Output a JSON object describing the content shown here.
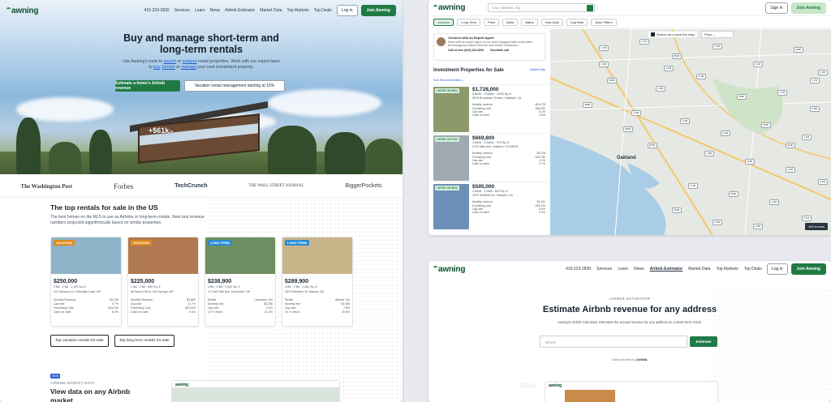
{
  "left": {
    "nav": {
      "logo": "awning",
      "phone": "415-223-2830",
      "links": [
        "Services",
        "Learn",
        "News",
        "Airbnb Estimator",
        "Market Data",
        "Top Markets",
        "Top Deals"
      ],
      "login": "Log in",
      "join": "Join Awning"
    },
    "hero": {
      "title": "Buy and manage short-term and long-term rentals",
      "subtitle_prefix": "Use Awning's tools to",
      "link_search": "search",
      "subtitle_or": "or",
      "link_analyze": "analyze",
      "subtitle_mid": "rental properties. Work with our expert team to",
      "link_buy": "buy",
      "link_furnish": "furnish",
      "subtitle_or2": "or",
      "link_manage": "manage",
      "subtitle_end": "your next investment property.",
      "cta_primary": "Estimate a home's Airbnb revenue",
      "cta_secondary": "Vacation rental management starting at 15%",
      "price_badge": "+$61k",
      "price_unit": "/yr"
    },
    "press": [
      "The Washington Post",
      "Forbes",
      "TechCrunch",
      "THE WALL STREET JOURNAL",
      "BiggerPockets"
    ],
    "top_rentals": {
      "title": "The top rentals for sale in the US",
      "subtitle": "The best homes on the MLS to use as Airbnbs or long-term rentals. Rent and revenue numbers projected algorithmically based on similar properties."
    },
    "cards": [
      {
        "tag": "VACATION",
        "tag_color": "#e08a1e",
        "price": "$250,000",
        "meta": "3 Bd · 2 Ba · 1,193 Sq. ft",
        "address": "101 Shepard Ln, Mountain Lake, AR",
        "rows": [
          [
            "Monthly Revenue",
            "$3,128"
          ],
          [
            "Cap rate",
            "9.7%"
          ],
          [
            "Furnishing Cost",
            "$14,226"
          ],
          [
            "Cash on cash",
            "8.4%"
          ]
        ],
        "img_color": "#8fb3c8"
      },
      {
        "tag": "VACATION",
        "tag_color": "#e08a1e",
        "price": "$225,000",
        "meta": "2 Bd · 1 Ba · 820 Sq. ft",
        "address": "88 Stone Hill Dr, Hot Springs, AR",
        "rows": [
          [
            "Monthly Revenue",
            "$3,880"
          ],
          [
            "Cap rate",
            "11.7%"
          ],
          [
            "Furnishing Cost",
            "$22,000"
          ],
          [
            "Cash on cash",
            "9.4%"
          ]
        ],
        "img_color": "#b0794f"
      },
      {
        "tag": "LONG TERM",
        "tag_color": "#2a8bd6",
        "price": "$238,900",
        "meta": "4 Bd · 2 Ba · 2,020 Sq. ft",
        "address": "12 Oak Park Ave, Cleveland, OH",
        "rows": [
          [
            "Rental",
            "Cleveland, OH"
          ],
          [
            "Monthly rent",
            "$2,250"
          ],
          [
            "Cap rate",
            "9.0%"
          ],
          [
            "10 Yr return",
            "21.3%"
          ]
        ],
        "img_color": "#6e8f62"
      },
      {
        "tag": "LONG TERM",
        "tag_color": "#2a8bd6",
        "price": "$289,900",
        "meta": "3 Bd · 2 Ba · 1,282 Sq. ft",
        "address": "450 Peachtree St, Atlanta, GA",
        "rows": [
          [
            "Rental",
            "Atlanta, GA"
          ],
          [
            "Monthly rent",
            "$2,350"
          ],
          [
            "Cap rate",
            "7.8%"
          ],
          [
            "10 Yr return",
            "19.9%"
          ]
        ],
        "img_color": "#c9b48a"
      }
    ],
    "btn_vacation": "Top vacation rentals for sale",
    "btn_longterm": "Top long term rentals for sale",
    "market": {
      "badge": "NEW",
      "eyebrow": "AIRBNB MARKET DATA",
      "title": "View data on any Airbnb market"
    }
  },
  "top_right": {
    "logo": "awning",
    "search_placeholder": "City, Address, Zip",
    "signin": "Sign in",
    "join": "Join Awning",
    "filters": [
      "Vacation",
      "Long Term",
      "Price",
      "Beds",
      "Baths",
      "Year Built",
      "Cap Rate",
      "More Filters"
    ],
    "expert": {
      "title": "Connect with an Expert Agent",
      "body": "Work with an expert agent on our team equipped with world-class technology and data to find the best Airbnb investment.",
      "call": "Call or text (415) 223-2830",
      "schedule": "Schedule call"
    },
    "list_title": "Investment Properties for Sale",
    "market_data": "Market Data",
    "sort_label": "Sort",
    "sort_value": "Recommended",
    "props": [
      {
        "tag": "LISTED ON 09/04",
        "price": "$1,728,000",
        "meta": "6 Beds · 3 Baths · 4,535 Sq. ft",
        "address": "3675 Broadway Terrace, Oakland, CA",
        "rows": [
          [
            "Monthly revenue",
            "$15,278"
          ],
          [
            "Furnishing cost",
            "$48,990"
          ],
          [
            "Cap rate",
            "5.1%"
          ],
          [
            "Cash on cash",
            "3.6%"
          ]
        ],
        "img_color": "#8c9a6a"
      },
      {
        "tag": "LISTED ON 07/22",
        "price": "$669,800",
        "meta": "3 Beds · 2 Baths · 978 Sq. ft",
        "address": "2723 38th Ave, Oakland, CA 94619",
        "rows": [
          [
            "Monthly revenue",
            "$3,078"
          ],
          [
            "Furnishing cost",
            "$18,780"
          ],
          [
            "Cap rate",
            "4.1%"
          ],
          [
            "Cash on cash",
            "2.7%"
          ]
        ],
        "img_color": "#9ea9b2"
      },
      {
        "tag": "LISTED ON 09/13",
        "price": "$595,000",
        "meta": "2 Beds · 1 Bath · 823 Sq. ft",
        "address": "2570 Sheffield Dr, Oakland, CA",
        "rows": [
          [
            "Monthly revenue",
            "$4,161"
          ],
          [
            "Furnishing cost",
            "$15,220"
          ],
          [
            "Cap rate",
            "5.0%"
          ],
          [
            "Cash on cash",
            "3.9%"
          ]
        ],
        "img_color": "#6e8fb8"
      }
    ],
    "map": {
      "search_move": "Search as I move the map",
      "price_dd": "Price",
      "city": "Oakland",
      "count": "263 homes",
      "markers": [
        "1.7M",
        "1.1M",
        "850K",
        "1.3M",
        "2.1M",
        "699K",
        "1.5M",
        "925K",
        "1.2M",
        "3.4M",
        "780K",
        "1.0M",
        "640K",
        "1.9M",
        "1.4M",
        "2.6M",
        "560K",
        "1.1M",
        "999K",
        "1.8M",
        "720K",
        "1.6M",
        "2.2M",
        "875K",
        "1.3M",
        "590K",
        "1.2M",
        "3.1M",
        "950K",
        "1.5M",
        "1.0M",
        "680K",
        "2.0M",
        "1.4M",
        "810K",
        "1.7M"
      ]
    }
  },
  "bottom_right": {
    "nav": {
      "logo": "awning",
      "phone": "415-223-2830",
      "links": [
        "Services",
        "Learn",
        "News",
        "Airbnb Estimator",
        "Market Data",
        "Top Markets",
        "Top Deals"
      ],
      "active": "Airbnb Estimator",
      "login": "Log in",
      "join": "Join Awning"
    },
    "eyebrow": "AIRBNB ESTIMATOR",
    "title": "Estimate Airbnb revenue for any address",
    "subtitle": "Awning's Airbnb Calculator estimates the annual revenue for any address as a short-term rental.",
    "input_placeholder": "Where",
    "button": "Estimate",
    "data_by_prefix": "Data provided by",
    "data_by": "AirDNA",
    "ghost_price": "$81k"
  }
}
